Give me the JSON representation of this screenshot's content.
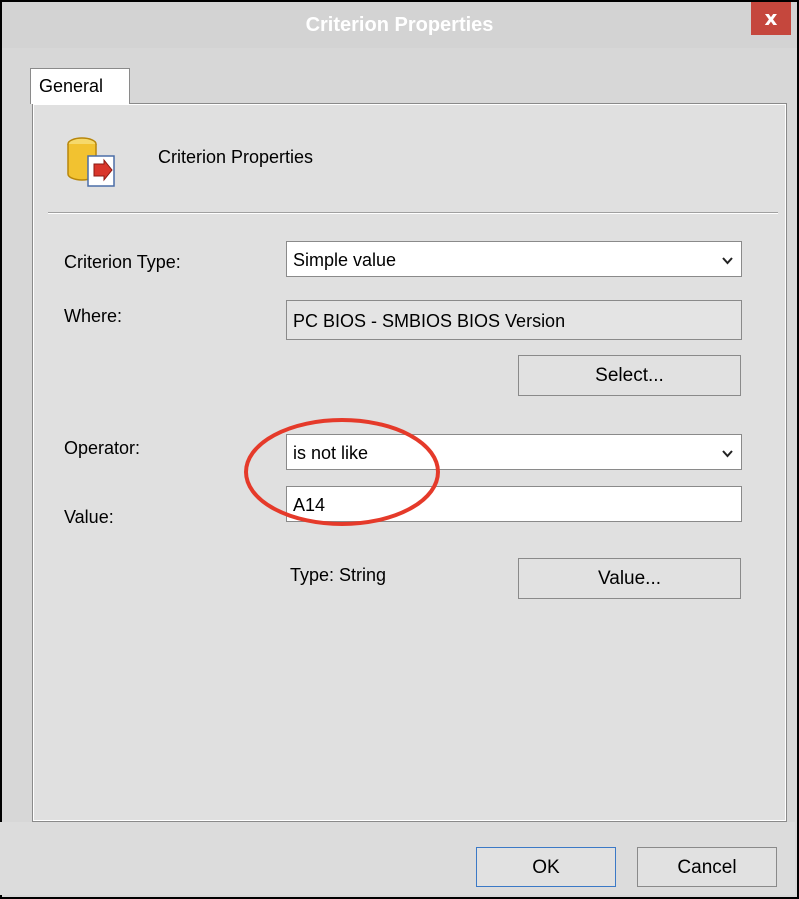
{
  "window": {
    "title": "Criterion Properties",
    "close_label": "x"
  },
  "tabs": [
    {
      "label": "General"
    }
  ],
  "header": {
    "text": "Criterion Properties"
  },
  "form": {
    "criterion_type": {
      "label": "Criterion Type:",
      "value": "Simple value"
    },
    "where": {
      "label": "Where:",
      "value": "PC BIOS - SMBIOS BIOS Version"
    },
    "select_button": "Select...",
    "operator": {
      "label": "Operator:",
      "value": "is not like"
    },
    "value": {
      "label": "Value:",
      "value": "A14"
    },
    "type_text": "Type: String",
    "value_button": "Value..."
  },
  "footer": {
    "ok_label": "OK",
    "cancel_label": "Cancel"
  },
  "colors": {
    "annotation_circle": "#e53a2a",
    "close_button": "#c5473d",
    "default_button_border": "#3b79c6"
  }
}
